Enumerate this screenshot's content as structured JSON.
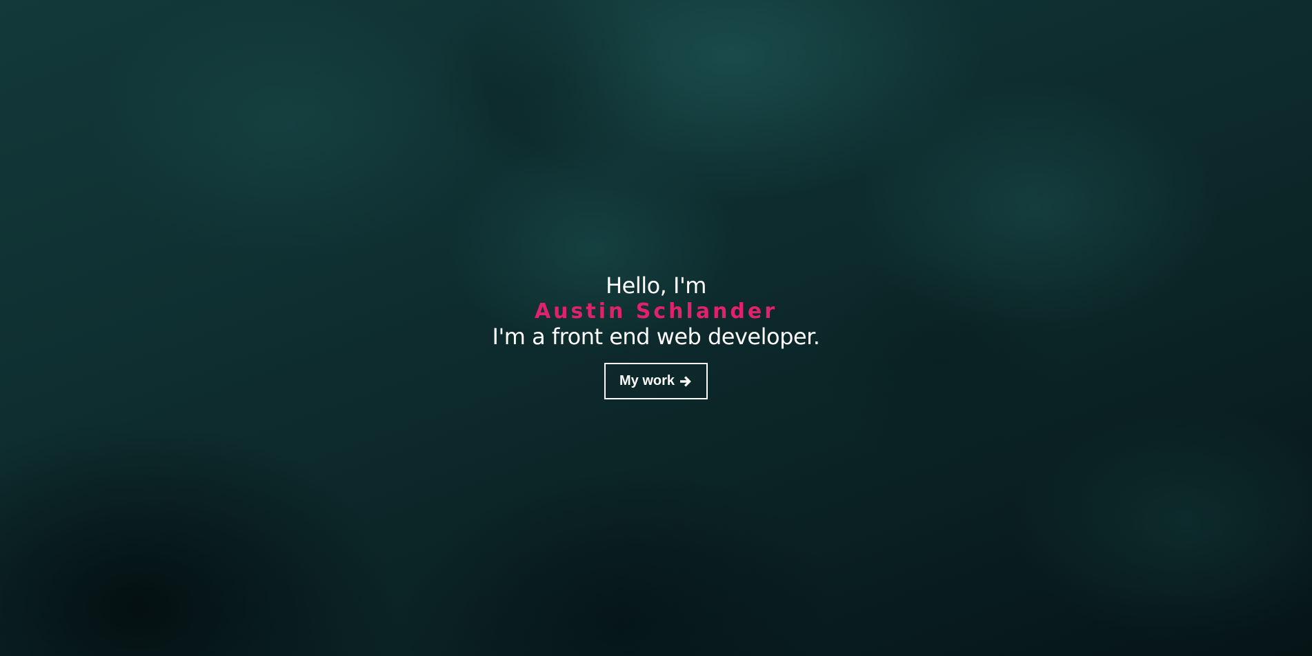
{
  "hero": {
    "greeting": "Hello, I'm",
    "name": "Austin Schlander",
    "tagline": "I'm a front end web developer.",
    "cta_label": "My work",
    "cta_icon": "arrow-right-icon"
  },
  "colors": {
    "accent": "#e0226b",
    "text": "#ffffff",
    "background": "#0c2426"
  }
}
